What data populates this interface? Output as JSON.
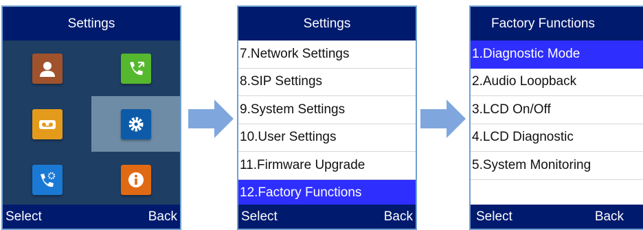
{
  "screen1": {
    "title": "Settings",
    "icons": [
      {
        "name": "contacts-icon",
        "color": "#a0522d"
      },
      {
        "name": "call-history-icon",
        "color": "#55b82e"
      },
      {
        "name": "voicemail-icon",
        "color": "#e49b1b"
      },
      {
        "name": "settings-gear-icon",
        "color": "#0d5ba8",
        "selected": true
      },
      {
        "name": "call-settings-icon",
        "color": "#1a79d4"
      },
      {
        "name": "info-icon",
        "color": "#e06a13"
      }
    ],
    "softkey_left": "Select",
    "softkey_right": "Back"
  },
  "screen2": {
    "title": "Settings",
    "items": [
      {
        "label": "7.Network Settings"
      },
      {
        "label": "8.SIP Settings"
      },
      {
        "label": "9.System Settings"
      },
      {
        "label": "10.User Settings"
      },
      {
        "label": "11.Firmware Upgrade"
      },
      {
        "label": "12.Factory Functions",
        "selected": true
      }
    ],
    "softkey_left": "Select",
    "softkey_right": "Back"
  },
  "screen3": {
    "title": "Factory Functions",
    "items": [
      {
        "label": "1.Diagnostic Mode",
        "selected": true
      },
      {
        "label": "2.Audio Loopback"
      },
      {
        "label": "3.LCD On/Off"
      },
      {
        "label": "4.LCD Diagnostic"
      },
      {
        "label": "5.System Monitoring"
      },
      {
        "label": ""
      }
    ],
    "softkey_left": "Select",
    "softkey_right": "Back"
  },
  "colors": {
    "title_bar": "#001a6e",
    "highlight": "#2e2eff",
    "icon_background": "#1e3e64",
    "icon_selected_background": "#6f8ca6",
    "arrow": "#7fa7dd"
  }
}
